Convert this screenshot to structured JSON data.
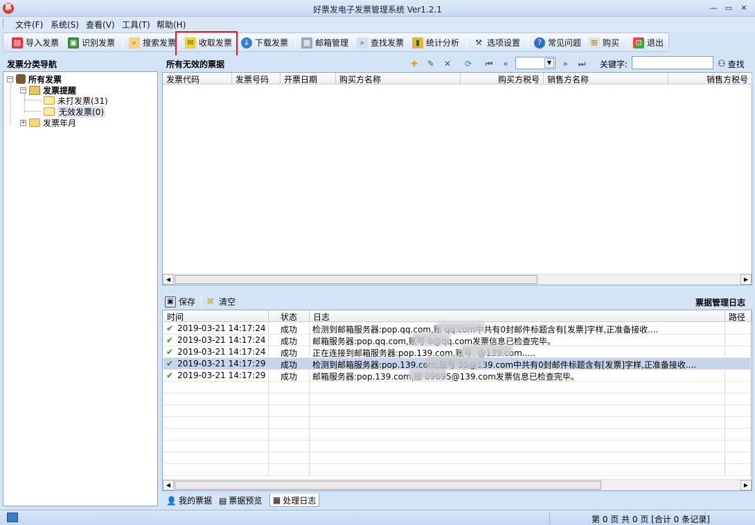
{
  "window": {
    "title": "好票发电子发票管理系统 Ver1.2.1",
    "icon": "app-logo-icon"
  },
  "menu": [
    {
      "label": "文件(F)"
    },
    {
      "label": "系统(S)"
    },
    {
      "label": "查看(V)"
    },
    {
      "label": "工具(T)"
    },
    {
      "label": "帮助(H)"
    }
  ],
  "toolbar": {
    "import": "导入发票",
    "recognize": "识别发票",
    "search": "搜索发票",
    "receive": "收取发票",
    "download": "下载发票",
    "mailbox": "邮箱管理",
    "find": "查找发票",
    "stats": "统计分析",
    "options": "选项设置",
    "faq": "常见问题",
    "buy": "购买",
    "exit": "退出"
  },
  "nav": {
    "header": "发票分类导航",
    "root": "所有发票",
    "reminder": "发票提醒",
    "unprinted": "未打发票(31)",
    "invalid": "无效发票(0)",
    "by_month": "发票年月"
  },
  "main": {
    "title": "所有无效的票据",
    "keyword_label": "关键字:",
    "keyword_value": "",
    "find_label": "查找",
    "columns": [
      "发票代码",
      "发票号码",
      "开票日期",
      "购买方名称",
      "购买方税号",
      "销售方名称",
      "销售方税号"
    ]
  },
  "log": {
    "save": "保存",
    "clear": "清空",
    "title": "票据管理日志",
    "columns": [
      "时间",
      "状态",
      "日志",
      "路径"
    ],
    "rows": [
      {
        "time": "2019-03-21 14:17:24",
        "status": "成功",
        "msg": "检测到邮箱服务器:pop.qq.com,账          qq.com中共有0封邮件标题含有[发票]字样,正准备接收....",
        "selected": false
      },
      {
        "time": "2019-03-21 14:17:24",
        "status": "成功",
        "msg": "邮箱服务器:pop.qq.com,账号        6@qq.com发票信息已检查完毕。",
        "selected": false
      },
      {
        "time": "2019-03-21 14:17:24",
        "status": "成功",
        "msg": "正在连接到邮箱服务器:pop.139.com,账号:         @139.com.....",
        "selected": false
      },
      {
        "time": "2019-03-21 14:17:29",
        "status": "成功",
        "msg": "检测到邮箱服务器:pop.139.com,账号          95@139.com中共有0封邮件标题含有[发票]字样,正准备接收....",
        "selected": true
      },
      {
        "time": "2019-03-21 14:17:29",
        "status": "成功",
        "msg": "邮箱服务器:pop.139.com,账         09695@139.com发票信息已检查完毕。",
        "selected": false
      }
    ]
  },
  "tabs": {
    "my_tickets": "我的票据",
    "preview": "票据预览",
    "log": "处理日志"
  },
  "status": {
    "page_info": "第 0 页 共 0 页 [合计 0 条记录]"
  }
}
